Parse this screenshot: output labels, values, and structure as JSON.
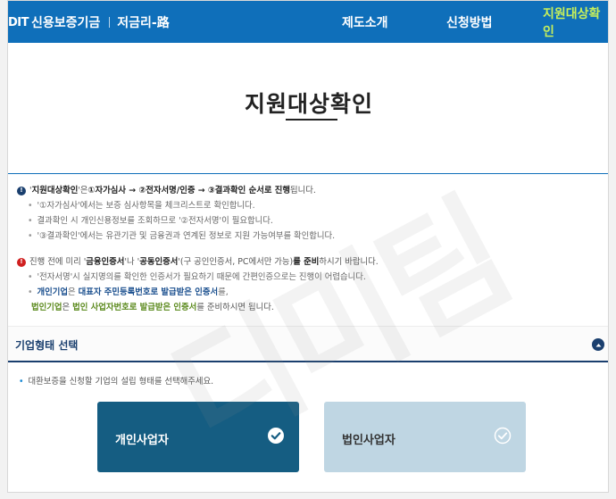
{
  "header": {
    "logo_mark": "DIT",
    "logo_name": "신용보증기금",
    "logo_sub": "저금리-路",
    "nav": [
      "제도소개",
      "신청방법",
      "지원대상확인"
    ],
    "active_nav_color": "#c8f05a",
    "bg_color": "#0f6fba"
  },
  "page_title": "지원대상확인",
  "notes": {
    "block1": {
      "q_open": "'",
      "term": "지원대상확인",
      "q_close": "'은 ",
      "steps": "①자가심사 → ②전자서명/인증 → ③결과확인 순서로 진행",
      "tail": " 됩니다.",
      "items": [
        "'①자가심사'에서는 보증 심사항목을 체크리스트로 확인합니다.",
        "결과확인 시 개인신용정보를 조회하므로 '②전자서명'이 필요합니다.",
        "'③결과확인'에서는 유관기관 및 금융권과 연계된 정보로 지원 가능여부를 확인합니다."
      ]
    },
    "block2": {
      "pre": "진행 전에 미리 '",
      "cert1": "금융인증서",
      "mid": "'나 '",
      "cert2": "공동인증서",
      "paren": "'(구 공인인증서, PC에서만 가능)",
      "prepare": "를 준비",
      "tail": "하시기 바랍니다.",
      "item": "'전자서명'시 실지명의를 확인한 인증서가 필요하기 때문에 간편인증으로는 진행이 어렵습니다.",
      "line_a": {
        "who": "개인기업",
        "s1": "은 ",
        "what": "대표자 주민등록번호로 발급받은 인증서",
        "s2": "를,"
      },
      "line_b": {
        "who": "법인기업",
        "s1": "은 ",
        "what": "법인 사업자번호로 발급받은 인증서",
        "s2": "를 준비하시면 됩니다."
      }
    }
  },
  "section": {
    "title": "기업형태 선택",
    "instruction": "대환보증을 신청할 기업의 설립 형태를 선택해주세요."
  },
  "cards": [
    {
      "label": "개인사업자",
      "selected": true
    },
    {
      "label": "법인사업자",
      "selected": false
    }
  ],
  "watermark": "디미팀"
}
